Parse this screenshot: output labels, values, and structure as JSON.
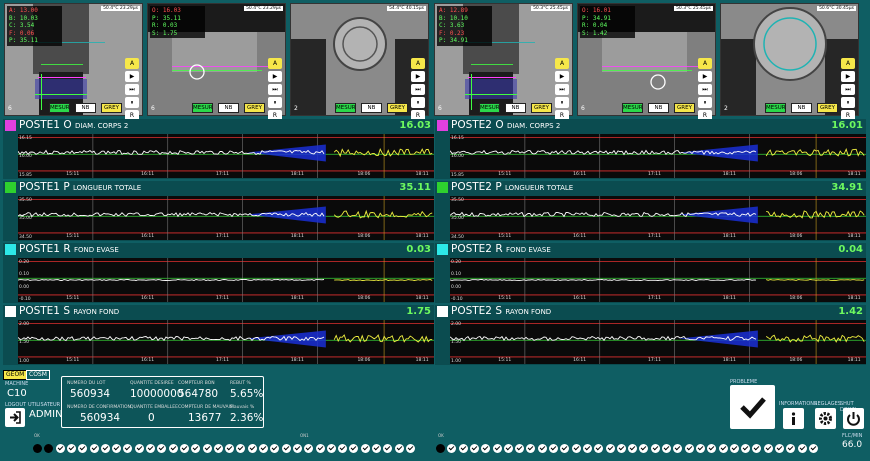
{
  "cameras": [
    {
      "id": "cam1",
      "info": [
        [
          "A: 13.00",
          "r"
        ],
        [
          "B: 10.03",
          "g"
        ],
        [
          "C: 3.54",
          "g"
        ],
        [
          "F: 0.06",
          "r"
        ],
        [
          "P: 35.11",
          "g"
        ]
      ],
      "status": "50.4°C 23.29µs",
      "num": "6",
      "buttons": [
        "MESUR",
        "NB",
        "GREY"
      ]
    },
    {
      "id": "cam2",
      "info": [
        [
          "O: 16.03",
          "r"
        ],
        [
          "P: 35.11",
          "g"
        ],
        [
          "R: 0.03",
          "g"
        ],
        [
          "S: 1.75",
          "g"
        ]
      ],
      "status": "50.4°C 23.29µs",
      "num": "6",
      "buttons": [
        "MESUR",
        "NB",
        "GREY"
      ]
    },
    {
      "id": "cam3",
      "info": [],
      "status": "54.4°C 40.15µs",
      "num": "2",
      "buttons": [
        "MESUR",
        "NB",
        "GREY"
      ]
    },
    {
      "id": "cam4",
      "info": [
        [
          "A: 12.89",
          "r"
        ],
        [
          "B: 10.10",
          "g"
        ],
        [
          "C: 3.63",
          "g"
        ],
        [
          "F: 0.23",
          "r"
        ],
        [
          "P: 34.91",
          "g"
        ]
      ],
      "status": "50.3°C 25.45µs",
      "num": "6",
      "buttons": [
        "MESUR",
        "NB",
        "GREY"
      ]
    },
    {
      "id": "cam5",
      "info": [
        [
          "O: 16.01",
          "r"
        ],
        [
          "P: 34.91",
          "g"
        ],
        [
          "R: 0.04",
          "g"
        ],
        [
          "S: 1.42",
          "g"
        ]
      ],
      "status": "50.3°C 25.45µs",
      "num": "6",
      "buttons": [
        "MESUR",
        "NB",
        "GREY"
      ]
    },
    {
      "id": "cam6",
      "info": [],
      "status": "50.6°C 30.45µs",
      "num": "2",
      "buttons": [
        "MESUR",
        "NB",
        "GREY"
      ]
    }
  ],
  "side_buttons": [
    "A",
    "▶",
    "⏭",
    "⏸",
    "R"
  ],
  "panels": [
    {
      "title": "POSTE1 O",
      "sub": "DIAM. CORPS 2",
      "value": "16.03",
      "color": "#e040e0",
      "y": [
        "16.15",
        "16.00",
        "15.85"
      ],
      "x": [
        "15:11",
        "16:11",
        "17:11",
        "18:11",
        "18:06",
        "18:11"
      ]
    },
    {
      "title": "POSTE2 O",
      "sub": "DIAM. CORPS 2",
      "value": "16.01",
      "color": "#e040e0",
      "y": [
        "16.15",
        "16.00",
        "15.85"
      ],
      "x": [
        "15:11",
        "16:11",
        "17:11",
        "18:11",
        "18:06",
        "18:11"
      ]
    },
    {
      "title": "POSTE1 P",
      "sub": "LONGUEUR TOTALE",
      "value": "35.11",
      "color": "#2ed12e",
      "y": [
        "35.50",
        "35.00",
        "34.50"
      ],
      "x": [
        "15:11",
        "16:11",
        "17:11",
        "18:11",
        "18:06",
        "18:11"
      ]
    },
    {
      "title": "POSTE2 P",
      "sub": "LONGUEUR TOTALE",
      "value": "34.91",
      "color": "#2ed12e",
      "y": [
        "35.50",
        "35.00",
        "34.50"
      ],
      "x": [
        "15:11",
        "16:11",
        "17:11",
        "18:11",
        "18:06",
        "18:11"
      ]
    },
    {
      "title": "POSTE1 R",
      "sub": "FOND EVASE",
      "value": "0.03",
      "color": "#2de8e8",
      "y": [
        "0.20",
        "0.10",
        "0.00",
        "-0.10"
      ],
      "x": [
        "15:11",
        "16:11",
        "17:11",
        "18:11",
        "18:06",
        "18:11"
      ]
    },
    {
      "title": "POSTE2 R",
      "sub": "FOND EVASE",
      "value": "0.04",
      "color": "#2de8e8",
      "y": [
        "0.20",
        "0.10",
        "0.00",
        "-0.10"
      ],
      "x": [
        "15:11",
        "16:11",
        "17:11",
        "18:11",
        "18:06",
        "18:11"
      ]
    },
    {
      "title": "POSTE1 S",
      "sub": "RAYON FOND",
      "value": "1.75",
      "color": "#ffffff",
      "y": [
        "2.00",
        "1.50",
        "1.00"
      ],
      "x": [
        "15:11",
        "16:11",
        "17:11",
        "18:11",
        "18:06",
        "18:11"
      ]
    },
    {
      "title": "POSTE2 S",
      "sub": "RAYON FOND",
      "value": "1.42",
      "color": "#ffffff",
      "y": [
        "2.00",
        "1.50",
        "1.00"
      ],
      "x": [
        "15:11",
        "16:11",
        "17:11",
        "18:11",
        "18:06",
        "18:11"
      ]
    }
  ],
  "left": {
    "geom": "GEOM",
    "cosm": "COSM",
    "machine_lbl": "MACHINE",
    "machine": "C10",
    "user_lbl": "UTILISATEUR",
    "user": "ADMIN",
    "logout": "LOGOUT"
  },
  "info": {
    "lot_lbl": "NUMERO DU LOT",
    "lot": "560934",
    "qd_lbl": "QUANTITE DESIREE",
    "qd": "10000000",
    "cb_lbl": "COMPTEUR BON",
    "cb": "564780",
    "rej_lbl": "REBUT %",
    "rej": "5.65%",
    "conf_lbl": "NUMERO DE CONFIRMATION",
    "conf": "560934",
    "qe_lbl": "QUANTITE EMBALLEE",
    "qe": "0",
    "cm_lbl": "COMPTEUR DE MAUVAIS",
    "cm": "13677",
    "mv_lbl": "Mauvais %",
    "mv": "2.36%"
  },
  "right": {
    "prob_lbl": "PROBLEME",
    "inf_lbl": "INFORMATIONS",
    "reg_lbl": "REGLAGES",
    "sd_lbl": "SHUT DOWN",
    "rate_lbl": "FLC/MIN",
    "rate": "66.0"
  },
  "micro": [
    "OK",
    "ON1",
    "OK"
  ]
}
